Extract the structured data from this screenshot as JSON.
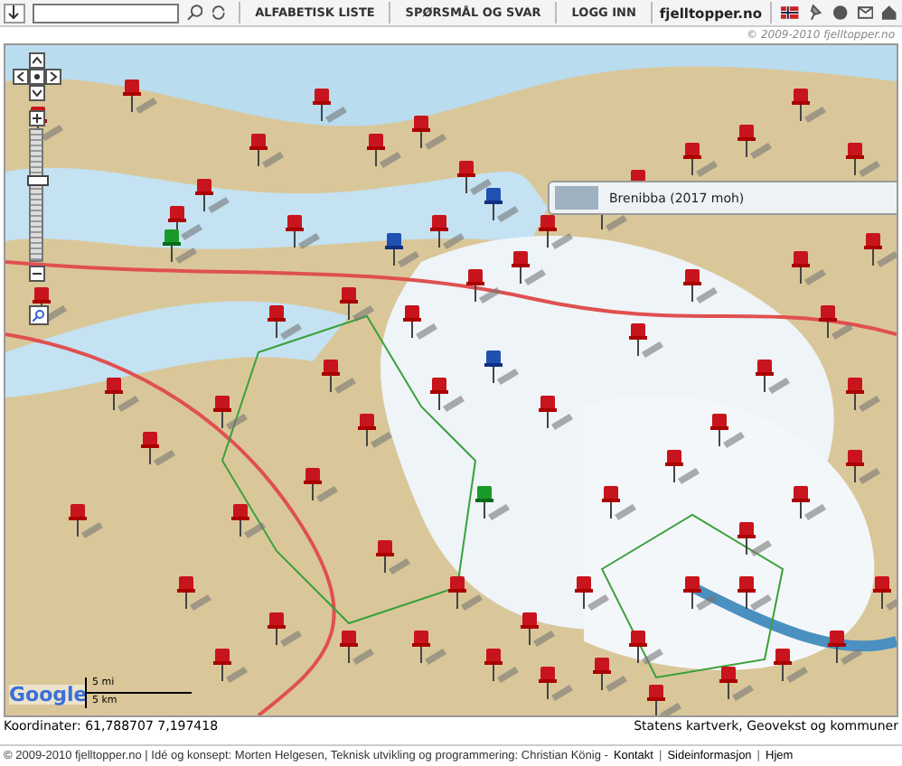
{
  "toolbar": {
    "menu": [
      "ALFABETISK LISTE",
      "SPØRSMÅL OG SVAR",
      "LOGG INN"
    ],
    "site_title": "fjelltopper.no"
  },
  "copyright_top": "© 2009-2010 fjelltopper.no",
  "map": {
    "zoom": {
      "level": 0.63
    },
    "tooltip": {
      "label": "Brenibba (2017 moh)"
    },
    "scale": {
      "miles": "5 mi",
      "km": "5 km"
    },
    "logo": "Google"
  },
  "coordinates": "Koordinater: 61,788707 7,197418",
  "map_credit": "Statens kartverk, Geovekst og kommuner",
  "footer": [
    {
      "kind": "text",
      "text": "© 2009-2010 fjelltopper.no | Idé og konsept: Morten Helgesen, Teknisk utvikling og programmering: Christian König  -"
    },
    {
      "kind": "link",
      "text": "Kontakt"
    },
    {
      "kind": "sep",
      "text": "|"
    },
    {
      "kind": "link",
      "text": "Sideinformasjon"
    },
    {
      "kind": "sep",
      "text": "|"
    },
    {
      "kind": "link",
      "text": "Hjem"
    }
  ]
}
